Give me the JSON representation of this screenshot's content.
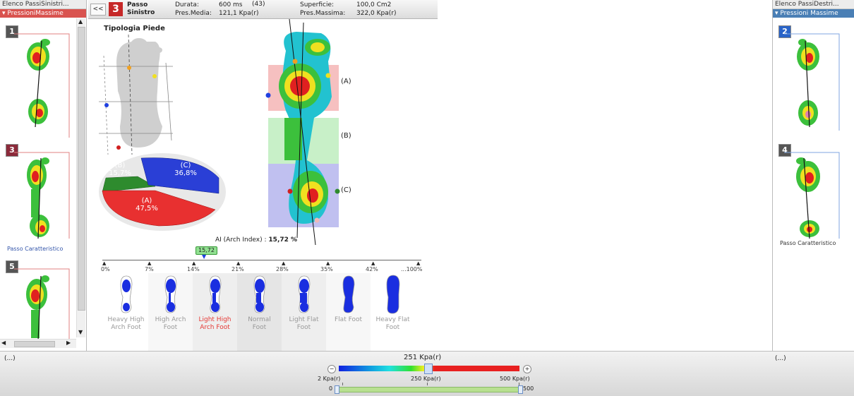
{
  "left_panel": {
    "title": "Elenco PassiSinistri...",
    "subtitle": "PressioniMassime",
    "items": [
      {
        "badge": "1",
        "label": ""
      },
      {
        "badge": "3",
        "label": "Passo Caratteristico"
      },
      {
        "badge": "5",
        "label": ""
      }
    ]
  },
  "right_panel": {
    "title": "Elenco PassiDestri...",
    "subtitle": "Pressioni Massime",
    "items": [
      {
        "badge": "2",
        "label": ""
      },
      {
        "badge": "4",
        "label": "Passo Caratteristico"
      }
    ]
  },
  "header": {
    "collapse_label": "<<",
    "step_number": "3",
    "step_name_line1": "Passo",
    "step_name_line2": "Sinistro",
    "durata_label": "Durata:",
    "durata_value": "600 ms",
    "durata_count": "(43)",
    "pres_media_label": "Pres.Media:",
    "pres_media_value": "121,1 Kpa(r)",
    "superficie_label": "Superficie:",
    "superficie_value": "100,0 Cm2",
    "pres_massima_label": "Pres.Massima:",
    "pres_massima_value": "322,0 Kpa(r)"
  },
  "main": {
    "tipologia_title": "Tipologia Piede",
    "pie": [
      {
        "label": "(A)",
        "value": "47,5%",
        "color": "#e83030"
      },
      {
        "label": "(B)",
        "value": "15,7%",
        "color": "#2e8b2e"
      },
      {
        "label": "(C)",
        "value": "36,8%",
        "color": "#2a3fd6"
      }
    ],
    "zones": [
      "(A)",
      "(B)",
      "(C)"
    ],
    "arch_index_label": "AI (Arch Index) :",
    "arch_index_value": "15,72 %",
    "slider_value": "15,72",
    "scale_ticks": [
      "0%",
      "7%",
      "14%",
      "21%",
      "28%",
      "35%",
      "42%",
      "...100%"
    ],
    "foot_types": [
      {
        "line1": "Heavy High",
        "line2": "Arch Foot"
      },
      {
        "line1": "High Arch",
        "line2": "Foot"
      },
      {
        "line1": "Light High",
        "line2": "Arch Foot"
      },
      {
        "line1": "Normal",
        "line2": "Foot"
      },
      {
        "line1": "Light Flat",
        "line2": "Foot"
      },
      {
        "line1": "Flat Foot",
        "line2": ""
      },
      {
        "line1": "Heavy Flat",
        "line2": "Foot"
      }
    ]
  },
  "bottom": {
    "left_dots": "(...)",
    "right_dots": "(...)",
    "current_value": "251 Kpa(r)",
    "min_label": "2 Kpa(r)",
    "mid_label": "250 Kpa(r)",
    "max_label": "500 Kpa(r)",
    "range_min": "0",
    "range_max": "500",
    "minus_label": "−",
    "plus_label": "+"
  }
}
